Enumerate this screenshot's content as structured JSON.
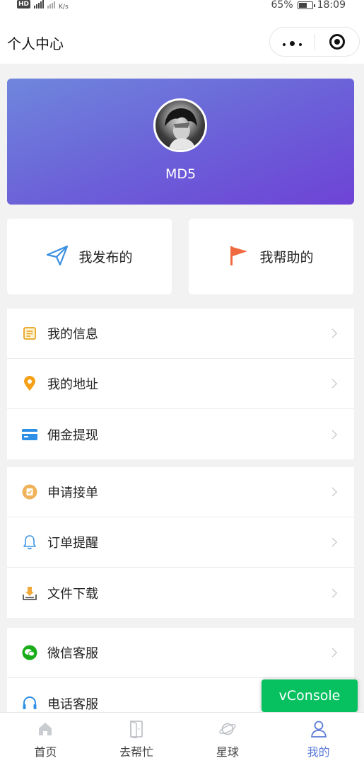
{
  "status_bar": {
    "network_badge": "HD",
    "speed": "K/s",
    "battery": "65%",
    "time": "18:09"
  },
  "nav": {
    "title": "个人中心"
  },
  "profile": {
    "username": "MD5"
  },
  "quick_actions": [
    {
      "label": "我发布的",
      "icon": "paper-plane-icon"
    },
    {
      "label": "我帮助的",
      "icon": "flag-icon"
    }
  ],
  "menu_groups": [
    [
      {
        "label": "我的信息",
        "icon": "info-card-icon"
      },
      {
        "label": "我的地址",
        "icon": "location-pin-icon"
      },
      {
        "label": "佣金提现",
        "icon": "bank-card-icon"
      }
    ],
    [
      {
        "label": "申请接单",
        "icon": "apply-badge-icon"
      },
      {
        "label": "订单提醒",
        "icon": "bell-icon"
      },
      {
        "label": "文件下载",
        "icon": "download-icon"
      }
    ],
    [
      {
        "label": "微信客服",
        "icon": "wechat-icon"
      },
      {
        "label": "电话客服",
        "icon": "headset-icon"
      }
    ]
  ],
  "vconsole": {
    "label": "vConsole"
  },
  "tabs": [
    {
      "label": "首页",
      "icon": "home-icon"
    },
    {
      "label": "去帮忙",
      "icon": "door-icon"
    },
    {
      "label": "星球",
      "icon": "planet-icon"
    },
    {
      "label": "我的",
      "icon": "user-icon",
      "active": true
    }
  ],
  "colors": {
    "accent": "#5b7bd8",
    "banner_start": "#6f86dc",
    "banner_end": "#6e43d6",
    "vconsole": "#07c160"
  }
}
